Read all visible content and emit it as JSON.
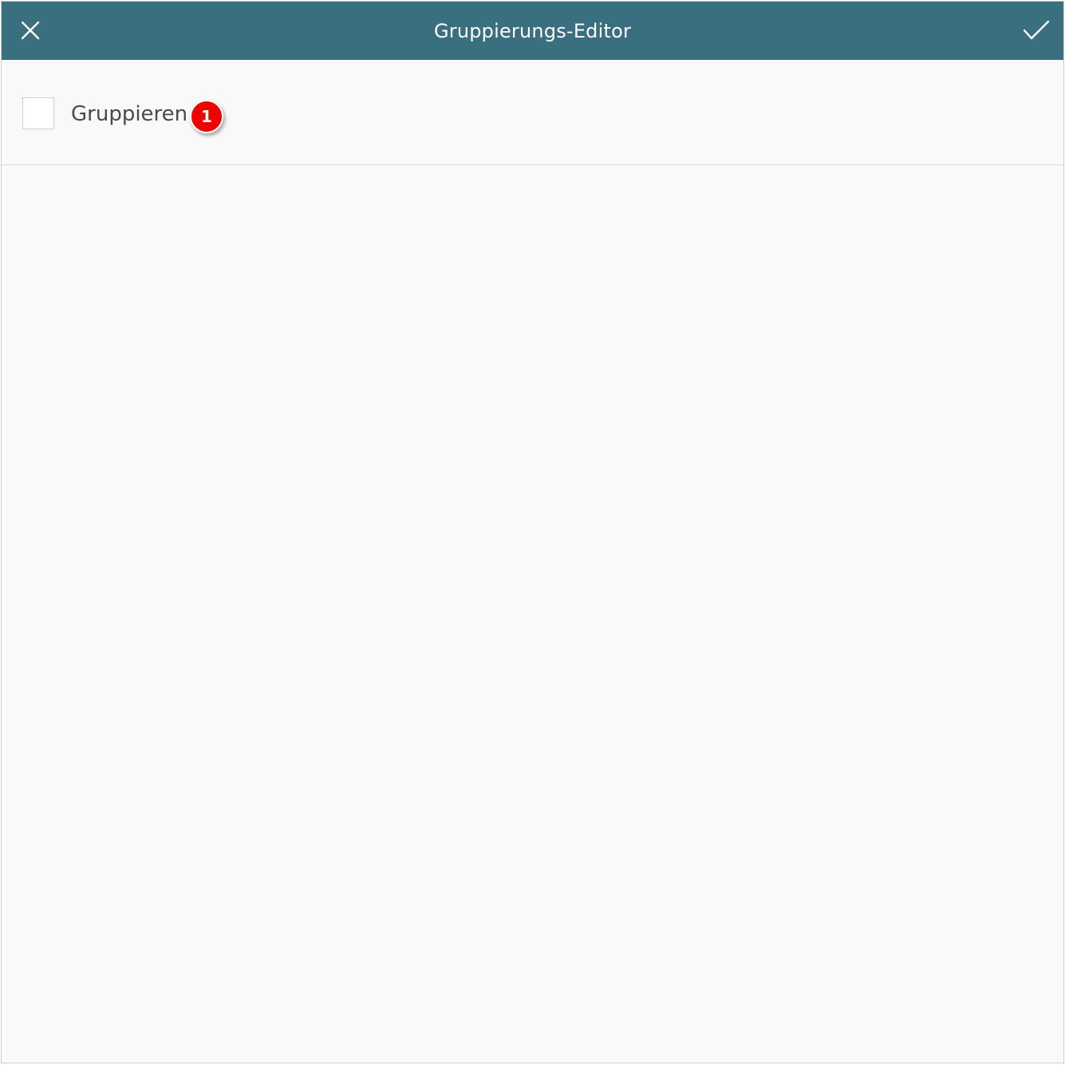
{
  "header": {
    "title": "Gruppierungs-Editor",
    "close_icon": "close-icon",
    "confirm_icon": "checkmark-icon",
    "background_color": "#3a6f80"
  },
  "group_option": {
    "label": "Gruppieren",
    "checked": false,
    "badge": "1",
    "badge_color": "#ee0000"
  }
}
